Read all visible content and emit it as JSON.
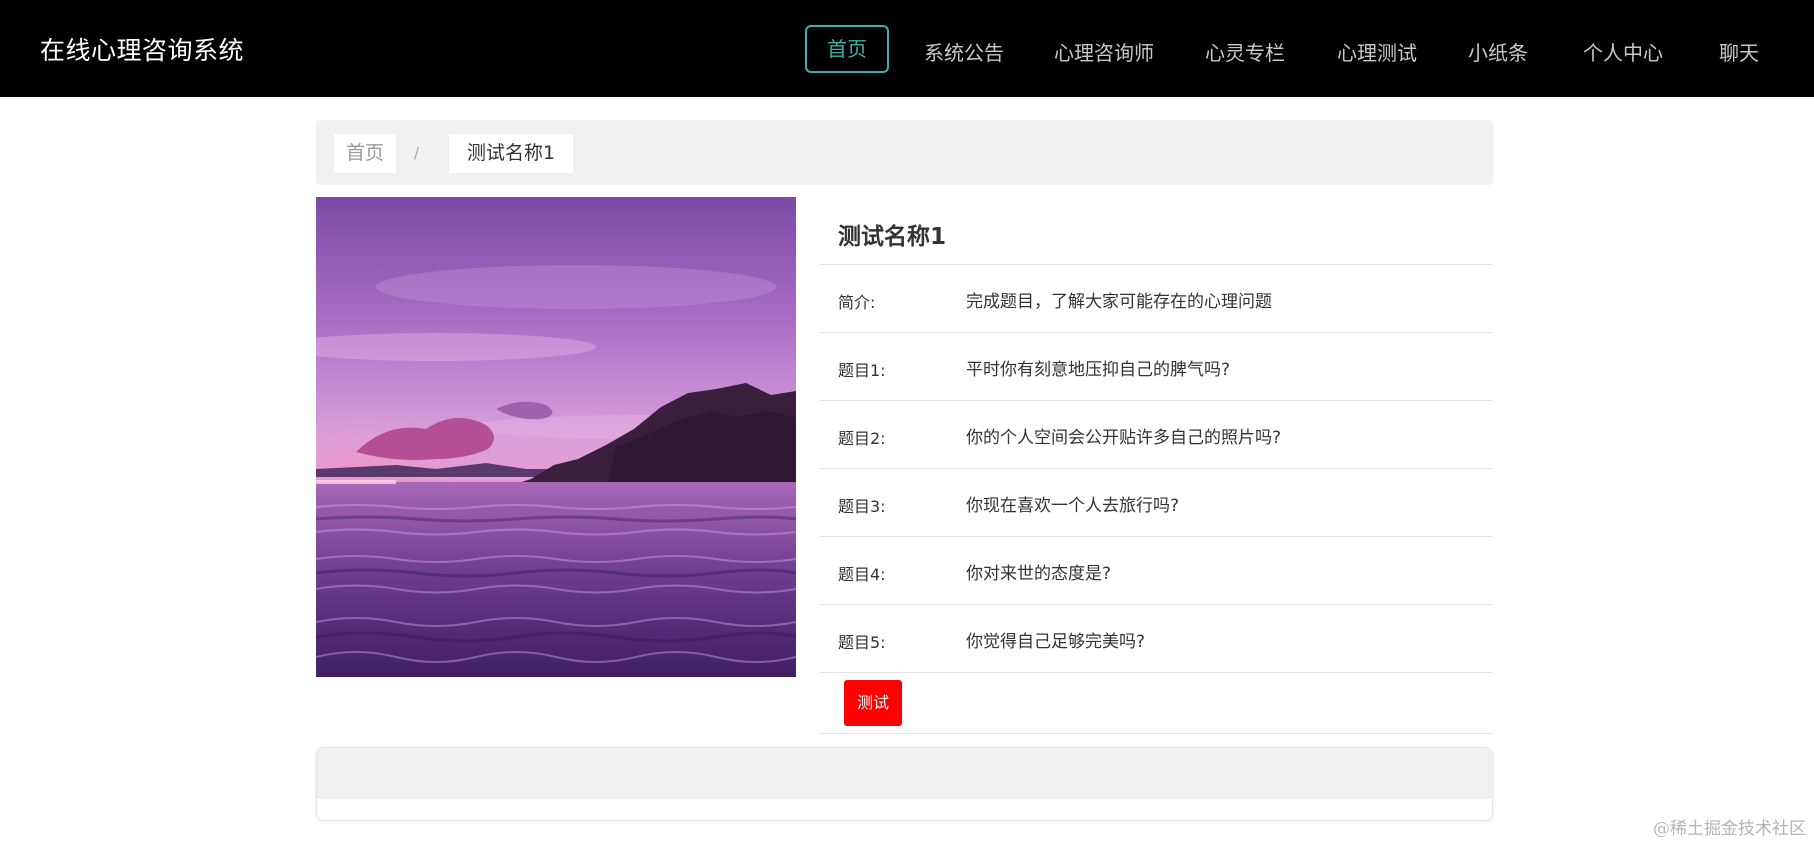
{
  "header": {
    "brand": "在线心理咨询系统",
    "nav": [
      {
        "label": "首页",
        "active": true
      },
      {
        "label": "系统公告"
      },
      {
        "label": "心理咨询师"
      },
      {
        "label": "心灵专栏"
      },
      {
        "label": "心理测试"
      },
      {
        "label": "小纸条"
      },
      {
        "label": "个人中心"
      },
      {
        "label": "聊天"
      }
    ]
  },
  "breadcrumb": {
    "home": "首页",
    "separator": "/",
    "current": "测试名称1"
  },
  "detail": {
    "title": "测试名称1",
    "rows": [
      {
        "label": "简介:",
        "value": "完成题目，了解大家可能存在的心理问题"
      },
      {
        "label": "题目1:",
        "value": "平时你有刻意地压抑自己的脾气吗?"
      },
      {
        "label": "题目2:",
        "value": "你的个人空间会公开贴许多自己的照片吗?"
      },
      {
        "label": "题目3:",
        "value": "你现在喜欢一个人去旅行吗?"
      },
      {
        "label": "题目4:",
        "value": "你对来世的态度是?"
      },
      {
        "label": "题目5:",
        "value": "你觉得自己足够完美吗?"
      }
    ],
    "test_button": "测试"
  },
  "watermark": "@稀土掘金技术社区",
  "colors": {
    "nav_bg": "#000000",
    "accent": "#3fb0a8",
    "button": "#ff0000",
    "panel_bg": "#f1f1f1"
  }
}
